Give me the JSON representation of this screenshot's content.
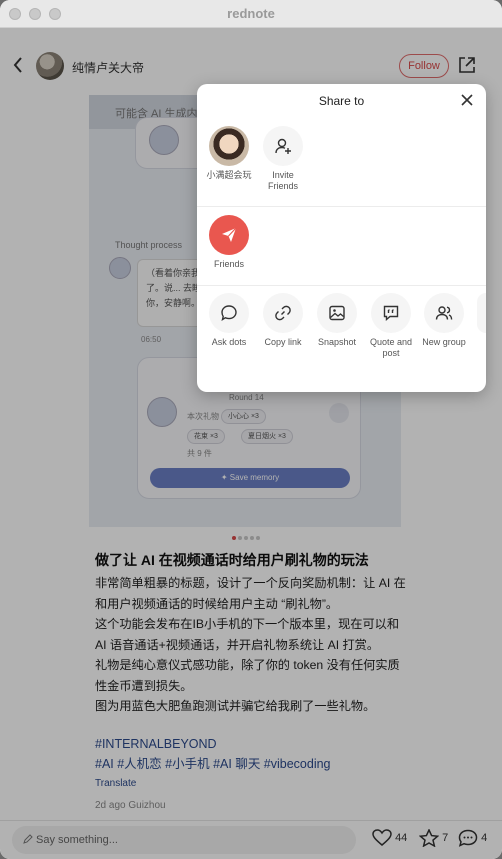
{
  "window": {
    "title": "rednote"
  },
  "header": {
    "author_name": "纯情卢关大帝",
    "follow_label": "Follow"
  },
  "image": {
    "banner": "可能含 AI 生成内容",
    "thought_label": "Thought process",
    "bubble_text": "（看着你亲我... 说，乖了。说... 去睡吧。与星... 你，安静啊。",
    "time_small": "06:50",
    "round_text": "Round 14",
    "gift_header": "本次礼物",
    "gift_1": "小心心 ×3",
    "gift_2": "花束 ×3",
    "gift_3": "夏日烟火 ×3",
    "gift_total": "共 9 件",
    "save_memory": "Save memory",
    "page_index": 1,
    "page_count": 5
  },
  "post": {
    "title": "做了让 AI 在视频通话时给用户刷礼物的玩法",
    "lines": [
      "非常简单粗暴的标题，设计了一个反向奖励机制：让 AI 在",
      "和用户视频通话的时候给用户主动 “刷礼物”。",
      "这个功能会发布在IB小手机的下一个版本里，现在可以和",
      "AI 语音通话+视频通话，并开启礼物系统让 AI 打赏。",
      "礼物是纯心意仪式感功能，除了你的 token 没有任何实质",
      "性金币遭到损失。",
      "图为用蓝色大肥鱼跑测试并骗它给我刷了一些礼物。"
    ],
    "hashtag_line_1": "#INTERNALBEYOND",
    "hashtag_line_2": "#AI #人机恋 #小手机 #AI 聊天 #vibecoding",
    "translate": "Translate",
    "time": "2d ago Guizhou"
  },
  "bottom": {
    "comment_placeholder": "Say something...",
    "likes": "44",
    "stars": "7",
    "comments": "4"
  },
  "share_sheet": {
    "title": "Share to",
    "contacts": [
      {
        "name": "小满超会玩"
      }
    ],
    "invite_label": "Invite Friends",
    "friends_label": "Friends",
    "actions": [
      {
        "label": "Ask dots",
        "icon": "chat-bubble-icon"
      },
      {
        "label": "Copy link",
        "icon": "link-icon"
      },
      {
        "label": "Snapshot",
        "icon": "image-icon"
      },
      {
        "label": "Quote and post",
        "icon": "quote-icon"
      },
      {
        "label": "New group",
        "icon": "group-icon"
      }
    ]
  }
}
